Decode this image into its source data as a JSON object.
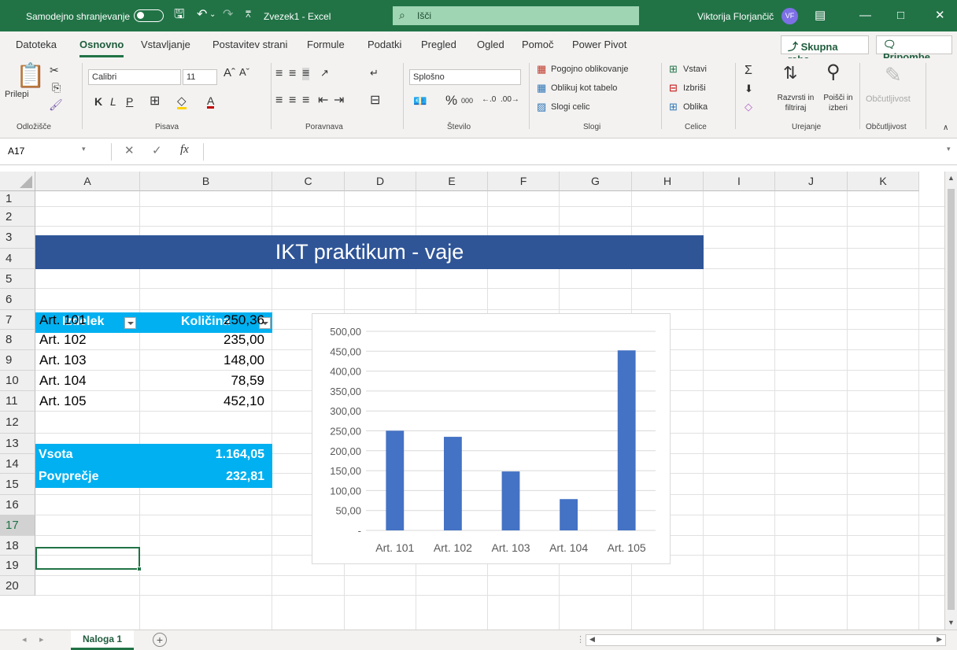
{
  "titlebar": {
    "autosave": "Samodejno shranjevanje",
    "docname": "Zvezek1  -  Excel",
    "search": "Išči",
    "user": "Viktorija Florjančič",
    "initials": "VF"
  },
  "tabs": [
    "Datoteka",
    "Osnovno",
    "Vstavljanje",
    "Postavitev strani",
    "Formule",
    "Podatki",
    "Pregled",
    "Ogled",
    "Pomoč",
    "Power Pivot"
  ],
  "share": "Skupna raba",
  "comments": "Pripombe",
  "ribbon": {
    "paste": "Prilepi",
    "font_name": "Calibri",
    "font_size": "11",
    "bold": "K",
    "italic": "L",
    "underline": "P",
    "number_format": "Splošno",
    "conditional": "Pogojno oblikovanje",
    "as_table": "Oblikuj kot tabelo",
    "cell_styles": "Slogi celic",
    "insert": "Vstavi",
    "delete": "Izbriši",
    "format": "Oblika",
    "sort_filter": "Razvrsti in filtriraj",
    "find_select": "Poišči in izberi",
    "sensitivity": "Občutljivost",
    "groups": {
      "clipboard": "Odložišče",
      "font": "Pisava",
      "alignment": "Poravnava",
      "number": "Število",
      "styles": "Slogi",
      "cells": "Celice",
      "editing": "Urejanje",
      "sensitivity": "Občutljivost"
    }
  },
  "formula_bar": {
    "namebox": "A17",
    "fx": "fx"
  },
  "columns": [
    "A",
    "B",
    "C",
    "D",
    "E",
    "F",
    "G",
    "H",
    "I",
    "J",
    "K"
  ],
  "rows": [
    "1",
    "2",
    "3",
    "4",
    "5",
    "6",
    "7",
    "8",
    "9",
    "10",
    "11",
    "12",
    "13",
    "14",
    "15",
    "16",
    "17",
    "18",
    "19",
    "20"
  ],
  "banner": "IKT praktikum - vaje",
  "table": {
    "headers": [
      "Izdelek",
      "Količina"
    ],
    "rows": [
      [
        "Art. 101",
        "250,36"
      ],
      [
        "Art. 102",
        "235,00"
      ],
      [
        "Art. 103",
        "148,00"
      ],
      [
        "Art. 104",
        "78,59"
      ],
      [
        "Art. 105",
        "452,10"
      ]
    ],
    "sum_label": "Vsota",
    "sum_value": "1.164,05",
    "avg_label": "Povprečje",
    "avg_value": "232,81"
  },
  "chart_data": {
    "type": "bar",
    "categories": [
      "Art. 101",
      "Art. 102",
      "Art. 103",
      "Art. 104",
      "Art. 105"
    ],
    "values": [
      250.36,
      235.0,
      148.0,
      78.59,
      452.1
    ],
    "ylim": [
      0,
      500
    ],
    "yticks": [
      "-",
      "50,00",
      "100,00",
      "150,00",
      "200,00",
      "250,00",
      "300,00",
      "350,00",
      "400,00",
      "450,00",
      "500,00"
    ],
    "grid": true,
    "bar_color": "#4472c4"
  },
  "sheet_tab": "Naloga 1",
  "colors": {
    "excel_green": "#217346",
    "banner": "#2f5597",
    "table_header": "#00b0f0"
  }
}
